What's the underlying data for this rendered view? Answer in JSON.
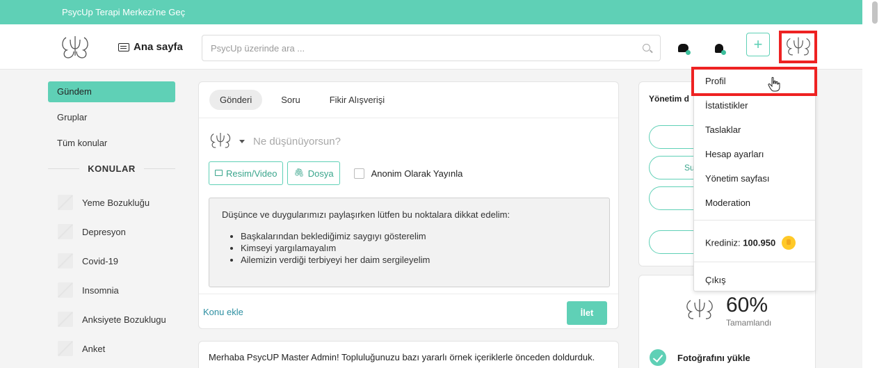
{
  "topbar": {
    "text": "PsycUp Terapi Merkezi'ne Geç"
  },
  "header": {
    "home_label": "Ana sayfa",
    "search_placeholder": "PsycUp üzerinde ara ...",
    "plus_label": "+"
  },
  "sidebar": {
    "items": [
      {
        "label": "Gündem",
        "active": true
      },
      {
        "label": "Gruplar",
        "active": false
      },
      {
        "label": "Tüm konular",
        "active": false
      }
    ],
    "topics_heading": "KONULAR",
    "topics": [
      "Yeme Bozukluğu",
      "Depresyon",
      "Covid-19",
      "Insomnia",
      "Anksiyete Bozuklugu",
      "Anket"
    ]
  },
  "composer": {
    "tabs": [
      "Gönderi",
      "Soru",
      "Fikir Alışverişi"
    ],
    "placeholder": "Ne düşünüyorsun?",
    "media_button": "Resim/Video",
    "file_button": "Dosya",
    "anonymous_label": "Anonim Olarak Yayınla",
    "guidelines_intro": "Düşünce ve duygularımızı paylaşırken lütfen bu noktalara dikkat edelim:",
    "guidelines": [
      "Başkalarından beklediğimiz saygıyı gösterelim",
      "Kimseyi yargılamayalım",
      "Ailemizin verdiği terbiyeyi her daim sergileyelim"
    ],
    "add_topic": "Konu ekle",
    "send_button": "İlet"
  },
  "post": {
    "text": "Merhaba PsycUP Master Admin! Topluluğunuzu bazı yararlı örnek içeriklerle önceden doldurduk."
  },
  "admin_card": {
    "title": "Yönetim d",
    "pill_partial": "Su"
  },
  "progress": {
    "percent": "60%",
    "label": "Tamamlandı",
    "task": "Fotoğrafını yükle",
    "value": 0.6
  },
  "dropdown": {
    "items": [
      "Profil",
      "İstatistikler",
      "Taslaklar",
      "Hesap ayarları",
      "Yönetim sayfası",
      "Moderation"
    ],
    "credit_label": "Krediniz:",
    "credit_value": "100.950",
    "logout": "Çıkış"
  },
  "colors": {
    "accent": "#5fd0b6",
    "highlight": "#ee2222",
    "link": "#2d8fa1"
  }
}
